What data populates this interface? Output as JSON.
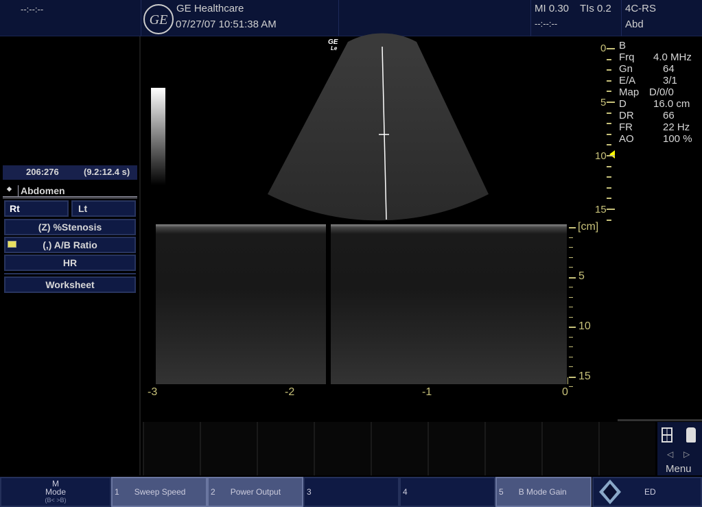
{
  "header": {
    "left_time": "--:--:--",
    "brand": "GE Healthcare",
    "datetime": "07/27/07 10:51:38 AM",
    "mi": "MI 0.30",
    "tis": "TIs 0.2",
    "timer": "--:--:--",
    "probe": "4C-RS",
    "preset": "Abd"
  },
  "counter": {
    "frames": "206:276",
    "time": "(9.2:12.4 s)"
  },
  "panel": {
    "category": "Abdomen",
    "rt": "Rt",
    "lt": "Lt",
    "items": [
      "(Z)  %Stenosis",
      "(,)  A/B Ratio",
      "HR",
      "Worksheet"
    ]
  },
  "image": {
    "probe_mark": "GE",
    "probe_mark_sub": "Le",
    "depth_labels": [
      "0",
      "5",
      "10",
      "15"
    ]
  },
  "params": [
    {
      "k": "B",
      "v": ""
    },
    {
      "k": "Frq",
      "v": "4.0 MHz"
    },
    {
      "k": "Gn",
      "v": "64"
    },
    {
      "k": "E/A",
      "v": "3/1"
    },
    {
      "k": "Map",
      "v": "D/0/0"
    },
    {
      "k": "D",
      "v": "16.0 cm"
    },
    {
      "k": "DR",
      "v": "66"
    },
    {
      "k": "FR",
      "v": "22 Hz"
    },
    {
      "k": "AO",
      "v": "100 %"
    }
  ],
  "mmode": {
    "unit": "[cm]",
    "depth_labels": [
      "5",
      "10",
      "15"
    ],
    "time_labels": [
      "-3",
      "-2",
      "-1",
      "0"
    ]
  },
  "menu": {
    "label": "Menu"
  },
  "softkeys": {
    "mode_top": "M",
    "mode": "Mode",
    "mode_sub": "(B< >B)",
    "keys": [
      {
        "n": "1",
        "label": "Sweep Speed"
      },
      {
        "n": "2",
        "label": "Power Output"
      },
      {
        "n": "3",
        "label": ""
      },
      {
        "n": "4",
        "label": ""
      },
      {
        "n": "5",
        "label": "B Mode Gain"
      }
    ],
    "ed": "ED"
  },
  "colors": {
    "bar": "#0b1436",
    "accent": "#c8c27a",
    "active_key": "#4a5680"
  }
}
